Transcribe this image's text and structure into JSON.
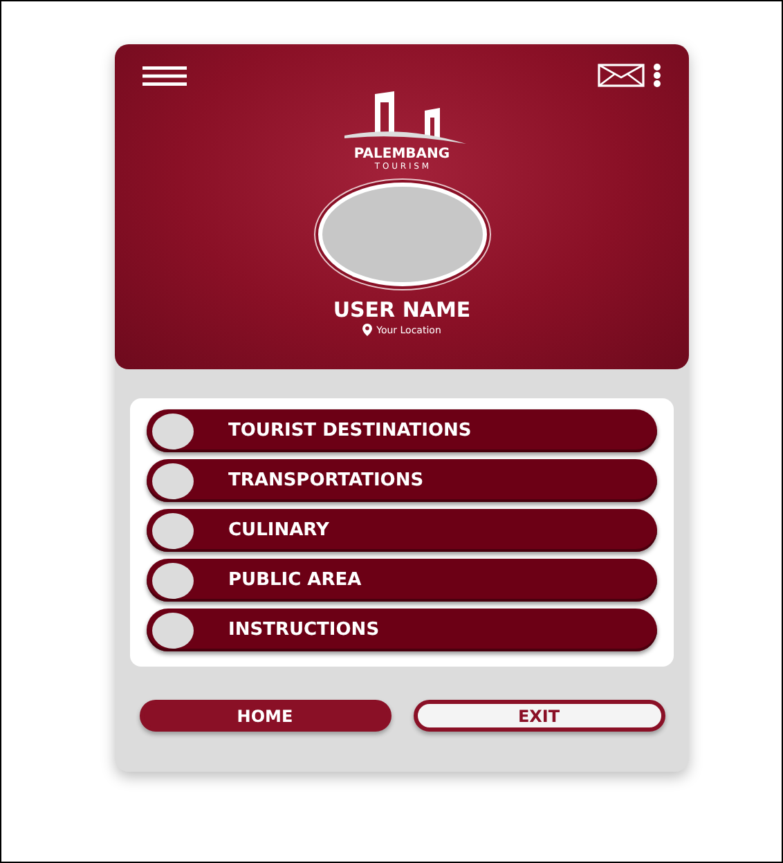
{
  "header": {
    "brand": "PALEMBANG",
    "tagline": "T O U R I S M",
    "user_name": "USER NAME",
    "location": "Your Location"
  },
  "menu": [
    {
      "label": "TOURIST DESTINATIONS"
    },
    {
      "label": "TRANSPORTATIONS"
    },
    {
      "label": "CULINARY"
    },
    {
      "label": "PUBLIC AREA"
    },
    {
      "label": "INSTRUCTIONS"
    }
  ],
  "buttons": [
    {
      "label": "HOME",
      "selected": true
    },
    {
      "label": "EXIT",
      "selected": false
    }
  ]
}
